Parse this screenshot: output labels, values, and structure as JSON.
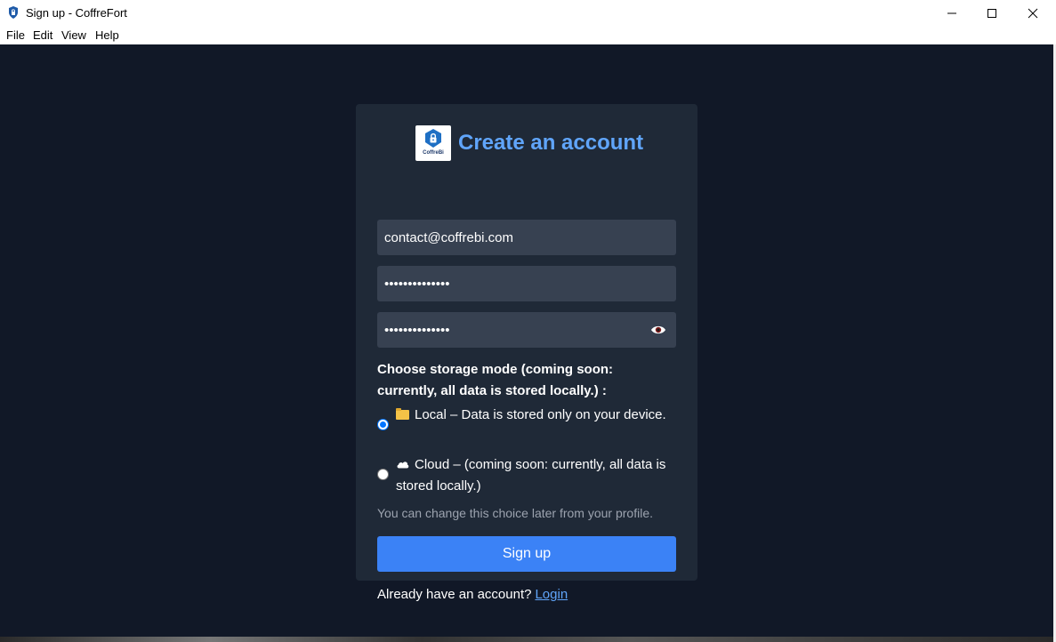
{
  "window": {
    "title": "Sign up - CoffreFort",
    "app_icon": "shield-lock-icon",
    "controls": [
      "minimize-icon",
      "maximize-icon",
      "close-icon"
    ]
  },
  "menu": {
    "file": "File",
    "edit": "Edit",
    "view": "View",
    "help": "Help"
  },
  "form": {
    "logo_text": "CoffreBi",
    "heading": "Create an account",
    "email_value": "contact@coffrebi.com",
    "password_value": "••••••••••••••",
    "confirm_value": "••••••••••••••",
    "storage_label": "Choose storage mode (coming soon: currently, all data is stored locally.) :",
    "options": [
      {
        "label": "Local – Data is stored only on your device.",
        "selected": true,
        "icon": "folder-icon"
      },
      {
        "label": "Cloud – (coming soon: currently, all data is stored locally.)",
        "selected": false,
        "icon": "cloud-icon"
      }
    ],
    "hint": "You can change this choice later from your profile.",
    "signup_label": "Sign up",
    "login_prompt": "Already have an account?",
    "login_link": "Login"
  },
  "colors": {
    "background": "#111827",
    "card": "#1f2937",
    "input": "#374151",
    "accent": "#3b82f6",
    "heading": "#60a5fa"
  }
}
